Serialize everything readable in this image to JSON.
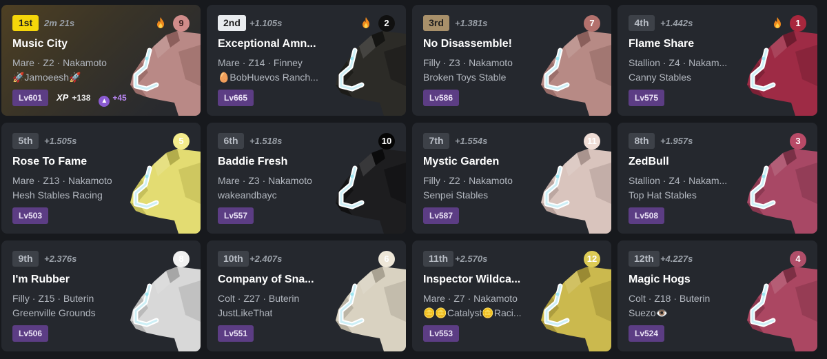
{
  "colors": {
    "card": "#25282e",
    "level_badge": "#5c3d84",
    "text_secondary": "#b2b7bf"
  },
  "cards": [
    {
      "position": "1st",
      "gap": "2m 21s",
      "hot": true,
      "gate": "9",
      "gate_bg": "#d08c8a",
      "gate_fg": "#3c1f1f",
      "name": "Music City",
      "details": "Mare · Z2 · Nakamoto",
      "owner": "🚀Jamoeesh🚀",
      "level": "Lv601",
      "xp_label": "XP",
      "xp_value": "+138",
      "amb_value": "+45",
      "horse_color": "#b98986",
      "horse_shade": "#8c5f5c"
    },
    {
      "position": "2nd",
      "gap": "+1.105s",
      "hot": true,
      "gate": "2",
      "gate_bg": "#101010",
      "gate_fg": "#ffffff",
      "name": "Exceptional Amn...",
      "details": "Mare · Z14 · Finney",
      "owner": "🥚BobHuevos Ranch...",
      "level": "Lv665",
      "horse_color": "#2c2b27",
      "horse_shade": "#151513"
    },
    {
      "position": "3rd",
      "gap": "+1.381s",
      "hot": false,
      "gate": "7",
      "gate_bg": "#b3716d",
      "gate_fg": "#ffffff",
      "name": "No Disassemble!",
      "details": "Filly · Z3 · Nakamoto",
      "owner": "Broken Toys Stable",
      "level": "Lv586",
      "horse_color": "#b78a85",
      "horse_shade": "#8a5f5b"
    },
    {
      "position": "4th",
      "gap": "+1.442s",
      "hot": true,
      "gate": "1",
      "gate_bg": "#a8273d",
      "gate_fg": "#ffffff",
      "name": "Flame Share",
      "details": "Stallion · Z4 · Nakam...",
      "owner": "Canny Stables",
      "level": "Lv575",
      "horse_color": "#9e2b45",
      "horse_shade": "#6e1c2f"
    },
    {
      "position": "5th",
      "gap": "+1.505s",
      "hot": false,
      "gate": "5",
      "gate_bg": "#f4ec8c",
      "gate_fg": "#ffffff",
      "name": "Rose To Fame",
      "details": "Mare · Z13 · Nakamoto",
      "owner": "Hesh Stables Racing",
      "level": "Lv503",
      "horse_color": "#e3dc72",
      "horse_shade": "#b3ad4c"
    },
    {
      "position": "6th",
      "gap": "+1.518s",
      "hot": false,
      "gate": "10",
      "gate_bg": "#050505",
      "gate_fg": "#ffffff",
      "name": "Baddie Fresh",
      "details": "Mare · Z3 · Nakamoto",
      "owner": "wakeandbayc",
      "level": "Lv557",
      "horse_color": "#1d1d1f",
      "horse_shade": "#0b0b0c"
    },
    {
      "position": "7th",
      "gap": "+1.554s",
      "hot": false,
      "gate": "11",
      "gate_bg": "#efddd6",
      "gate_fg": "#ffffff",
      "name": "Mystic Garden",
      "details": "Filly · Z2 · Nakamoto",
      "owner": "Senpei Stables",
      "level": "Lv587",
      "horse_color": "#d9c4bd",
      "horse_shade": "#a9948e"
    },
    {
      "position": "8th",
      "gap": "+1.957s",
      "hot": false,
      "gate": "3",
      "gate_bg": "#b84a67",
      "gate_fg": "#ffffff",
      "name": "ZedBull",
      "details": "Stallion · Z4 · Nakam...",
      "owner": "Top Hat Stables",
      "level": "Lv508",
      "horse_color": "#a84865",
      "horse_shade": "#7a3046"
    },
    {
      "position": "9th",
      "gap": "+2.376s",
      "hot": false,
      "gate": "8",
      "gate_bg": "#f1f1f1",
      "gate_fg": "#ffffff",
      "name": "I'm Rubber",
      "details": "Filly · Z15 · Buterin",
      "owner": "Greenville Grounds",
      "level": "Lv506",
      "horse_color": "#d8d8d8",
      "horse_shade": "#a6a6a6"
    },
    {
      "position": "10th",
      "gap": "+2.407s",
      "hot": false,
      "gate": "6",
      "gate_bg": "#eee7d8",
      "gate_fg": "#ffffff",
      "name": "Company of Sna...",
      "details": "Colt · Z27 · Buterin",
      "owner": "JustLikeThat",
      "level": "Lv551",
      "horse_color": "#d9d2c1",
      "horse_shade": "#a9a292"
    },
    {
      "position": "11th",
      "gap": "+2.570s",
      "hot": false,
      "gate": "12",
      "gate_bg": "#dccb55",
      "gate_fg": "#ffffff",
      "name": "Inspector Wildca...",
      "details": "Mare · Z7 · Nakamoto",
      "owner": "🪙🪙Catalyst🪙Raci...",
      "level": "Lv553",
      "horse_color": "#cbb94e",
      "horse_shade": "#9a8a33"
    },
    {
      "position": "12th",
      "gap": "+4.227s",
      "hot": false,
      "gate": "4",
      "gate_bg": "#b04e69",
      "gate_fg": "#ffffff",
      "name": "Magic Hogs",
      "details": "Colt · Z18 · Buterin",
      "owner": "Suezo👁️",
      "level": "Lv524",
      "horse_color": "#ab4762",
      "horse_shade": "#7c2f44"
    }
  ]
}
